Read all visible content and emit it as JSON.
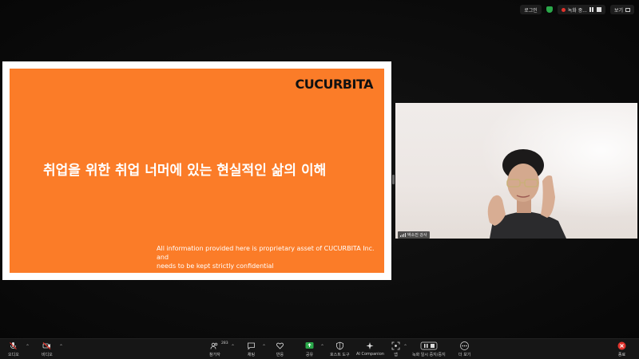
{
  "app": {
    "top_bar": {
      "login_label": "로그인",
      "recording_label": "녹화 중...",
      "view_label": "보기"
    },
    "slide": {
      "logo_text": "CUCURBITA",
      "title": "취업을 위한 취업 너머에 있는 현실적인 삶의 이해",
      "note_line1": "All information provided here is proprietary asset of CUCURBITA Inc. and",
      "note_line2": "needs to be kept strictly confidential",
      "accent_color": "#fb7c28"
    },
    "participant": {
      "name": "박소진 강사"
    },
    "toolbar": {
      "audio_label": "오디오",
      "video_label": "비디오",
      "participants_label": "참가자",
      "participants_count": "283",
      "chat_label": "채팅",
      "react_label": "반응",
      "share_label": "공유",
      "host_tools_label": "호스트 도구",
      "ai_companion_label": "AI Companion",
      "apps_label": "앱",
      "recording_label": "녹화 일시 중지/중지",
      "more_label": "더 보기",
      "end_label": "종료",
      "share_color": "#2aa84a",
      "end_color": "#e0332c",
      "muted_color": "#e0332c"
    }
  }
}
